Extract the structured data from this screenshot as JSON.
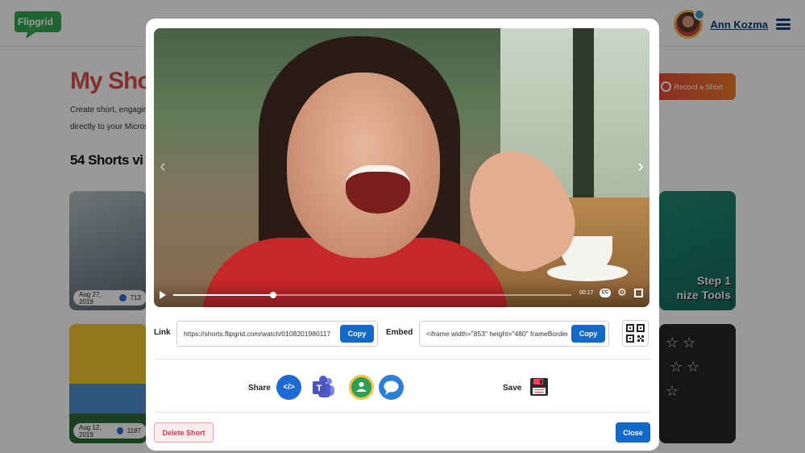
{
  "header": {
    "logo_text": "Flipgrid",
    "user_name": "Ann Kozma",
    "menu_icon": "hamburger-menu-icon"
  },
  "page": {
    "title": "My Shorts",
    "description_line1": "Create short, engaging",
    "description_line2": "directly to your Microso",
    "count_heading": "54 Shorts vi",
    "record_button": "Record a Short"
  },
  "cards": [
    {
      "date": "Aug 27, 2019",
      "views": "713"
    },
    {
      "date": "Aug 12, 2019",
      "views": "1187"
    },
    {
      "overlay_line1": "Step 1",
      "overlay_line2": "nize Tools"
    }
  ],
  "modal": {
    "video": {
      "current_time": "00:17",
      "progress_fraction": 0.25,
      "cc_label": "CC"
    },
    "link": {
      "label": "Link",
      "value": "https://shorts.flipgrid.com/watch/0108201980117",
      "copy_label": "Copy"
    },
    "embed": {
      "label": "Embed",
      "value": "<iframe width=\"853\" height=\"480\" frameBorder",
      "copy_label": "Copy"
    },
    "share": {
      "label": "Share",
      "embed_glyph": "</>",
      "icons": [
        "embed-code-icon",
        "microsoft-teams-icon",
        "google-classroom-icon",
        "remind-icon"
      ]
    },
    "save": {
      "label": "Save",
      "icon": "floppy-disk-icon"
    },
    "delete_label": "Delete Short",
    "close_label": "Close"
  },
  "colors": {
    "accent_blue": "#1369c8",
    "title_red": "#d9534f",
    "delete_red": "#d23a4c",
    "user_name_navy": "#0b3c78"
  }
}
